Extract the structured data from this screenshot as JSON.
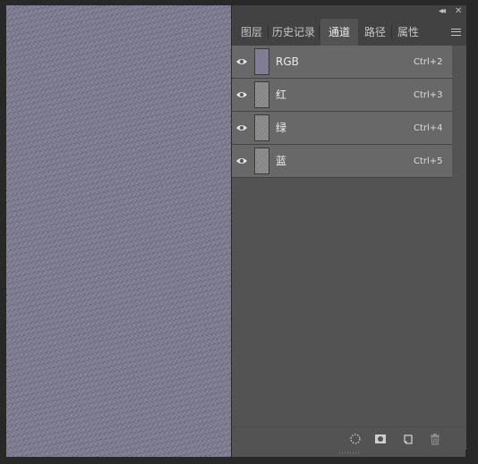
{
  "tabs": [
    {
      "label": "图层",
      "active": false
    },
    {
      "label": "历史记录",
      "active": false
    },
    {
      "label": "通道",
      "active": true
    },
    {
      "label": "路径",
      "active": false
    },
    {
      "label": "属性",
      "active": false
    }
  ],
  "channels": [
    {
      "name": "RGB",
      "shortcut": "Ctrl+2",
      "thumbnail": "rgb"
    },
    {
      "name": "红",
      "shortcut": "Ctrl+3",
      "thumbnail": "gray"
    },
    {
      "name": "绿",
      "shortcut": "Ctrl+4",
      "thumbnail": "gray"
    },
    {
      "name": "蓝",
      "shortcut": "Ctrl+5",
      "thumbnail": "gray"
    }
  ],
  "icons": {
    "collapse": "double-chevron-left-icon",
    "close": "close-icon",
    "menu": "hamburger-menu-icon",
    "visibility": "eye-icon",
    "load_selection": "dotted-circle-icon",
    "save_selection": "mask-icon",
    "new_channel": "new-channel-icon",
    "delete": "trash-icon"
  },
  "colors": {
    "canvas": "#7d7c92",
    "panel": "#535353",
    "row": "#686868",
    "tabbar": "#424242"
  }
}
